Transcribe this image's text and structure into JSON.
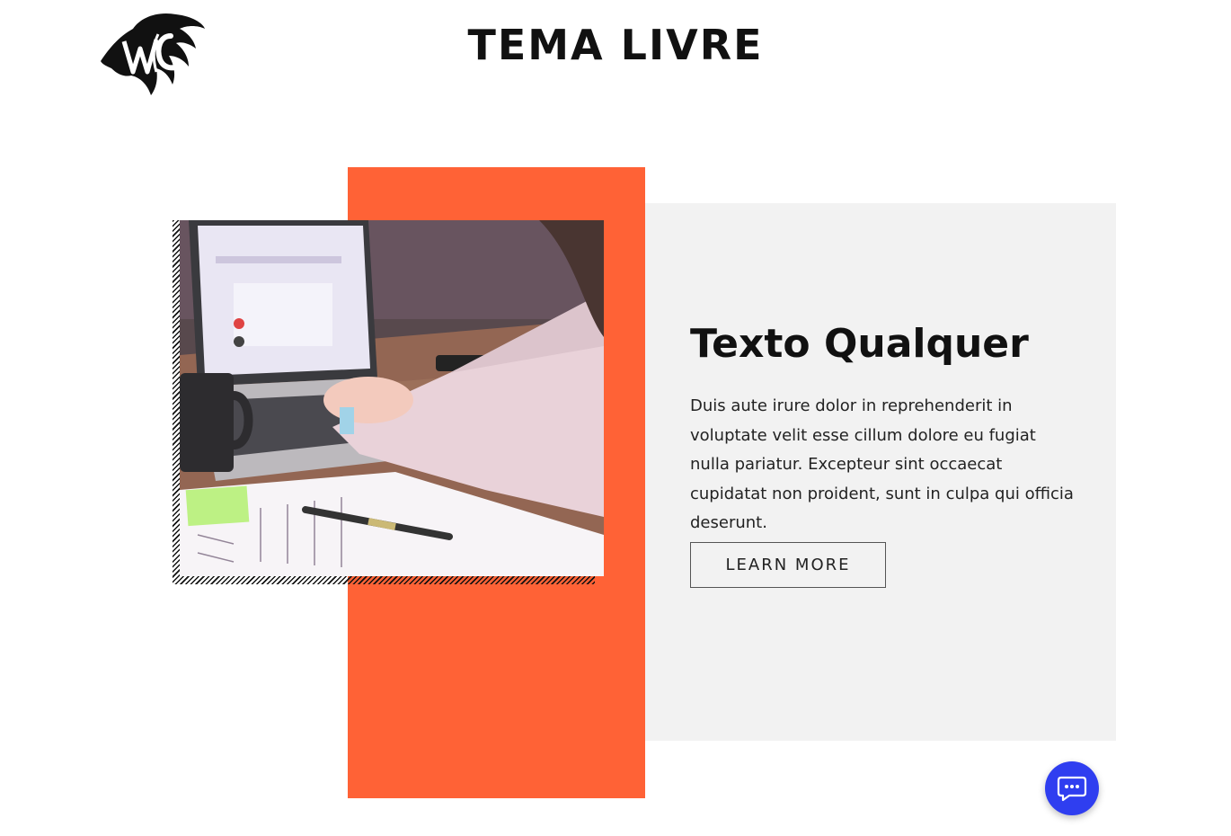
{
  "header": {
    "logo_text": "WSC",
    "title": "TEMA LIVRE"
  },
  "feature": {
    "image_alt": "Person typing on a laptop at a wooden desk with a mug, notes and a pen",
    "heading": "Texto Qualquer",
    "body": "Duis aute irure dolor in reprehenderit in voluptate velit esse cillum dolore eu fugiat nulla pariatur. Excepteur sint occaecat cupidatat non proident, sunt in culpa qui officia deserunt.",
    "button_label": "LEARN MORE"
  },
  "chat": {
    "icon": "chat-bubble-icon"
  },
  "colors": {
    "accent": "#ff6236",
    "card_bg": "#f2f2f2",
    "chat_button": "#2f3ef0",
    "text": "#111111"
  }
}
